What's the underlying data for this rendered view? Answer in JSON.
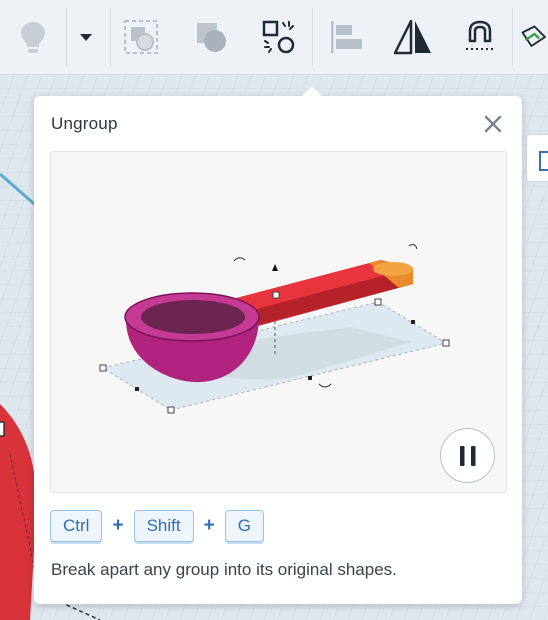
{
  "toolbar": {
    "buttons": [
      {
        "name": "light-bulb-icon"
      },
      {
        "name": "dropdown-arrow-icon"
      },
      {
        "name": "group-icon"
      },
      {
        "name": "ungroup-faded-icon"
      },
      {
        "name": "ungroup-icon"
      },
      {
        "name": "align-icon"
      },
      {
        "name": "mirror-icon"
      },
      {
        "name": "magnet-icon"
      },
      {
        "name": "workplane-icon"
      }
    ]
  },
  "popover": {
    "title": "Ungroup",
    "close_label": "×",
    "pause_label": "Pause",
    "shortcut": {
      "keys": [
        "Ctrl",
        "Shift",
        "G"
      ],
      "separator": "+"
    },
    "description": "Break apart any group into its original shapes."
  },
  "colors": {
    "accent": "#2f6fb3",
    "shape_red": "#e0303a",
    "shape_magenta": "#b0237e",
    "shape_orange": "#e88a2a"
  }
}
